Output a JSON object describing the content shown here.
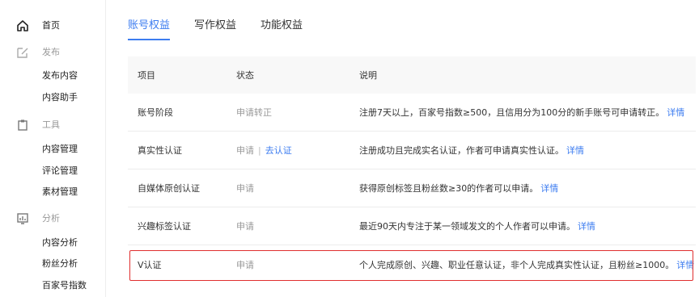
{
  "sidebar": {
    "home": {
      "label": "首页",
      "icon": "home-icon"
    },
    "publish": {
      "label": "发布",
      "icon": "edit-icon",
      "items": [
        "发布内容",
        "内容助手"
      ]
    },
    "tools": {
      "label": "工具",
      "icon": "clipboard-icon",
      "items": [
        "内容管理",
        "评论管理",
        "素材管理"
      ]
    },
    "analytics": {
      "label": "分析",
      "icon": "chart-icon",
      "items": [
        "内容分析",
        "粉丝分析",
        "百家号指数"
      ]
    }
  },
  "tabs": [
    {
      "label": "账号权益",
      "active": true
    },
    {
      "label": "写作权益",
      "active": false
    },
    {
      "label": "功能权益",
      "active": false
    }
  ],
  "table": {
    "headers": [
      "项目",
      "状态",
      "说明"
    ],
    "rows": [
      {
        "item": "账号阶段",
        "status": "申请转正",
        "desc": "注册7天以上，百家号指数≥500，且信用分为100分的新手账号可申请转正。",
        "link": "详情"
      },
      {
        "item": "真实性认证",
        "status": "申请",
        "status_link": "去认证",
        "desc": "注册成功且完成实名认证，作者可申请真实性认证。",
        "link": "详情"
      },
      {
        "item": "自媒体原创认证",
        "status": "申请",
        "desc": "获得原创标签且粉丝数≥30的作者可以申请。",
        "link": "详情"
      },
      {
        "item": "兴趣标签认证",
        "status": "申请",
        "desc": "最近90天内专注于某一领域发文的个人作者可以申请。",
        "link": "详情"
      },
      {
        "item": "V认证",
        "status": "申请",
        "desc": "个人完成原创、兴趣、职业任意认证，非个人完成真实性认证，且粉丝≥1000。",
        "link": "详情"
      }
    ]
  },
  "colors": {
    "accent": "#3c7cf0",
    "highlight": "#e02e2e"
  }
}
